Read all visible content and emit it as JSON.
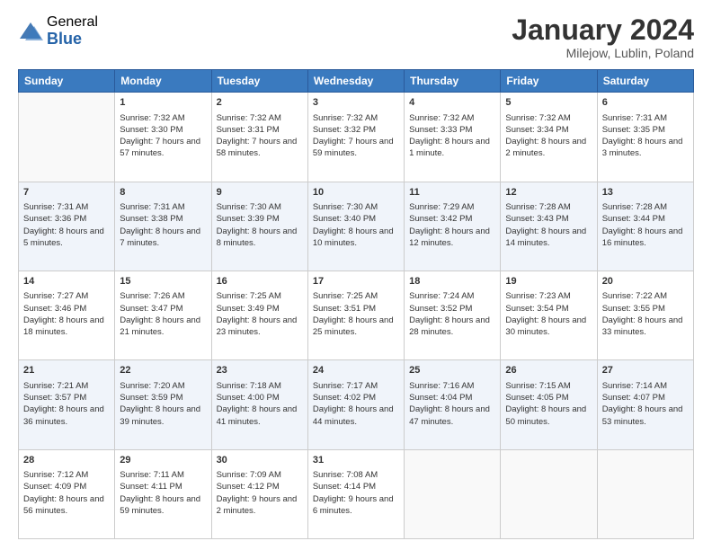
{
  "logo": {
    "general": "General",
    "blue": "Blue"
  },
  "title": "January 2024",
  "subtitle": "Milejow, Lublin, Poland",
  "days": [
    "Sunday",
    "Monday",
    "Tuesday",
    "Wednesday",
    "Thursday",
    "Friday",
    "Saturday"
  ],
  "weeks": [
    [
      {
        "empty": true
      },
      {
        "date": "1",
        "sunrise": "7:32 AM",
        "sunset": "3:30 PM",
        "daylight": "7 hours and 57 minutes."
      },
      {
        "date": "2",
        "sunrise": "7:32 AM",
        "sunset": "3:31 PM",
        "daylight": "7 hours and 58 minutes."
      },
      {
        "date": "3",
        "sunrise": "7:32 AM",
        "sunset": "3:32 PM",
        "daylight": "7 hours and 59 minutes."
      },
      {
        "date": "4",
        "sunrise": "7:32 AM",
        "sunset": "3:33 PM",
        "daylight": "8 hours and 1 minute."
      },
      {
        "date": "5",
        "sunrise": "7:32 AM",
        "sunset": "3:34 PM",
        "daylight": "8 hours and 2 minutes."
      },
      {
        "date": "6",
        "sunrise": "7:31 AM",
        "sunset": "3:35 PM",
        "daylight": "8 hours and 3 minutes."
      }
    ],
    [
      {
        "date": "7",
        "sunrise": "7:31 AM",
        "sunset": "3:36 PM",
        "daylight": "8 hours and 5 minutes."
      },
      {
        "date": "8",
        "sunrise": "7:31 AM",
        "sunset": "3:38 PM",
        "daylight": "8 hours and 7 minutes."
      },
      {
        "date": "9",
        "sunrise": "7:30 AM",
        "sunset": "3:39 PM",
        "daylight": "8 hours and 8 minutes."
      },
      {
        "date": "10",
        "sunrise": "7:30 AM",
        "sunset": "3:40 PM",
        "daylight": "8 hours and 10 minutes."
      },
      {
        "date": "11",
        "sunrise": "7:29 AM",
        "sunset": "3:42 PM",
        "daylight": "8 hours and 12 minutes."
      },
      {
        "date": "12",
        "sunrise": "7:28 AM",
        "sunset": "3:43 PM",
        "daylight": "8 hours and 14 minutes."
      },
      {
        "date": "13",
        "sunrise": "7:28 AM",
        "sunset": "3:44 PM",
        "daylight": "8 hours and 16 minutes."
      }
    ],
    [
      {
        "date": "14",
        "sunrise": "7:27 AM",
        "sunset": "3:46 PM",
        "daylight": "8 hours and 18 minutes."
      },
      {
        "date": "15",
        "sunrise": "7:26 AM",
        "sunset": "3:47 PM",
        "daylight": "8 hours and 21 minutes."
      },
      {
        "date": "16",
        "sunrise": "7:25 AM",
        "sunset": "3:49 PM",
        "daylight": "8 hours and 23 minutes."
      },
      {
        "date": "17",
        "sunrise": "7:25 AM",
        "sunset": "3:51 PM",
        "daylight": "8 hours and 25 minutes."
      },
      {
        "date": "18",
        "sunrise": "7:24 AM",
        "sunset": "3:52 PM",
        "daylight": "8 hours and 28 minutes."
      },
      {
        "date": "19",
        "sunrise": "7:23 AM",
        "sunset": "3:54 PM",
        "daylight": "8 hours and 30 minutes."
      },
      {
        "date": "20",
        "sunrise": "7:22 AM",
        "sunset": "3:55 PM",
        "daylight": "8 hours and 33 minutes."
      }
    ],
    [
      {
        "date": "21",
        "sunrise": "7:21 AM",
        "sunset": "3:57 PM",
        "daylight": "8 hours and 36 minutes."
      },
      {
        "date": "22",
        "sunrise": "7:20 AM",
        "sunset": "3:59 PM",
        "daylight": "8 hours and 39 minutes."
      },
      {
        "date": "23",
        "sunrise": "7:18 AM",
        "sunset": "4:00 PM",
        "daylight": "8 hours and 41 minutes."
      },
      {
        "date": "24",
        "sunrise": "7:17 AM",
        "sunset": "4:02 PM",
        "daylight": "8 hours and 44 minutes."
      },
      {
        "date": "25",
        "sunrise": "7:16 AM",
        "sunset": "4:04 PM",
        "daylight": "8 hours and 47 minutes."
      },
      {
        "date": "26",
        "sunrise": "7:15 AM",
        "sunset": "4:05 PM",
        "daylight": "8 hours and 50 minutes."
      },
      {
        "date": "27",
        "sunrise": "7:14 AM",
        "sunset": "4:07 PM",
        "daylight": "8 hours and 53 minutes."
      }
    ],
    [
      {
        "date": "28",
        "sunrise": "7:12 AM",
        "sunset": "4:09 PM",
        "daylight": "8 hours and 56 minutes."
      },
      {
        "date": "29",
        "sunrise": "7:11 AM",
        "sunset": "4:11 PM",
        "daylight": "8 hours and 59 minutes."
      },
      {
        "date": "30",
        "sunrise": "7:09 AM",
        "sunset": "4:12 PM",
        "daylight": "9 hours and 2 minutes."
      },
      {
        "date": "31",
        "sunrise": "7:08 AM",
        "sunset": "4:14 PM",
        "daylight": "9 hours and 6 minutes."
      },
      {
        "empty": true
      },
      {
        "empty": true
      },
      {
        "empty": true
      }
    ]
  ]
}
